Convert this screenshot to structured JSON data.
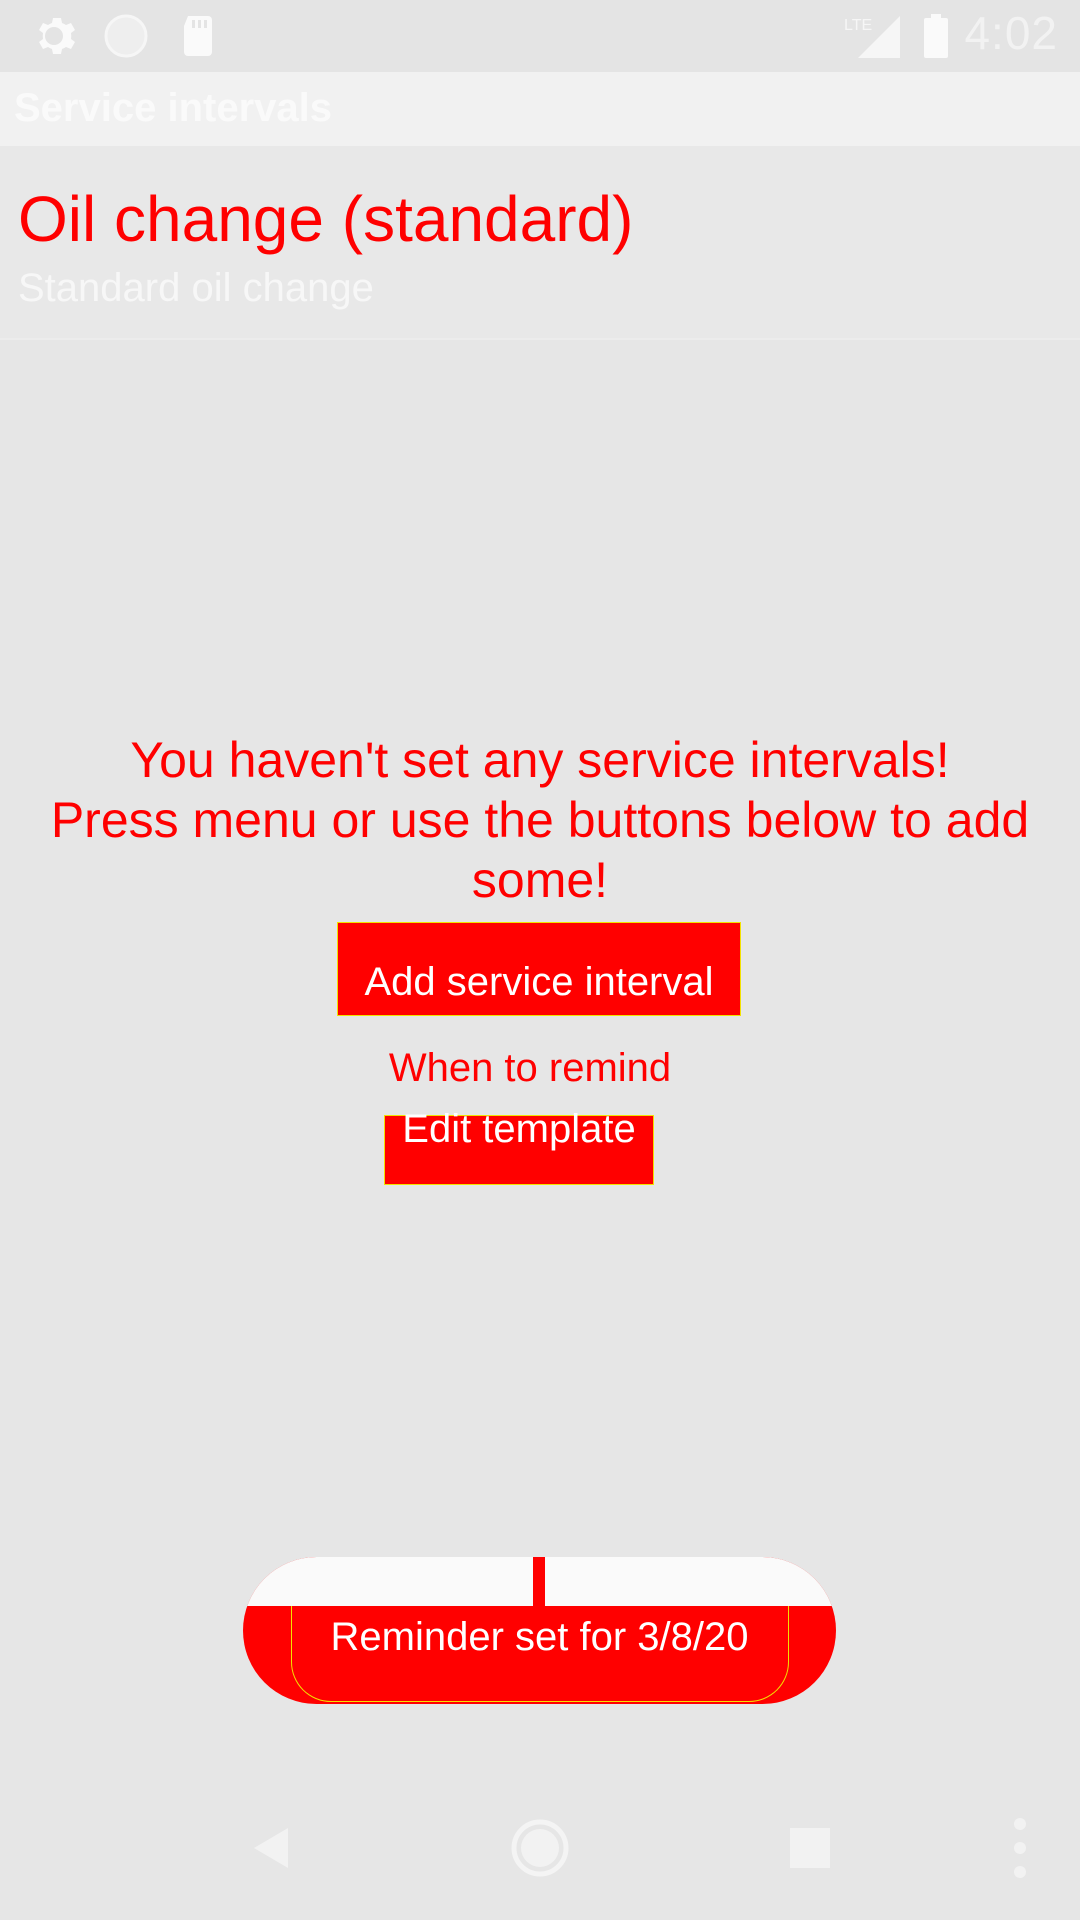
{
  "status_bar": {
    "time": "4:02",
    "network_label": "LTE",
    "icons": [
      "gear-icon",
      "circle-notification-icon",
      "sd-card-icon",
      "lte-signal-icon",
      "battery-icon"
    ]
  },
  "app_bar": {
    "title": "Service intervals"
  },
  "header": {
    "title": "Oil change (standard)",
    "subtitle": "Standard oil change"
  },
  "empty_state": {
    "line1": "You haven't set any service intervals!",
    "line2": "Press menu or use the buttons below to add some!"
  },
  "buttons": {
    "add_service_interval": "Add service interval",
    "when_to_remind": "When to remind",
    "edit_template": "Edit template"
  },
  "toast": {
    "message": "Reminder set for 3/8/20"
  },
  "nav_bar": {
    "icons": [
      "back-icon",
      "home-icon",
      "recents-icon",
      "overflow-menu-icon"
    ]
  },
  "colors": {
    "highlight": "#ff0000",
    "outline": "#f2e200",
    "background": "#e6e6e6",
    "white_text": "#ffffff"
  }
}
